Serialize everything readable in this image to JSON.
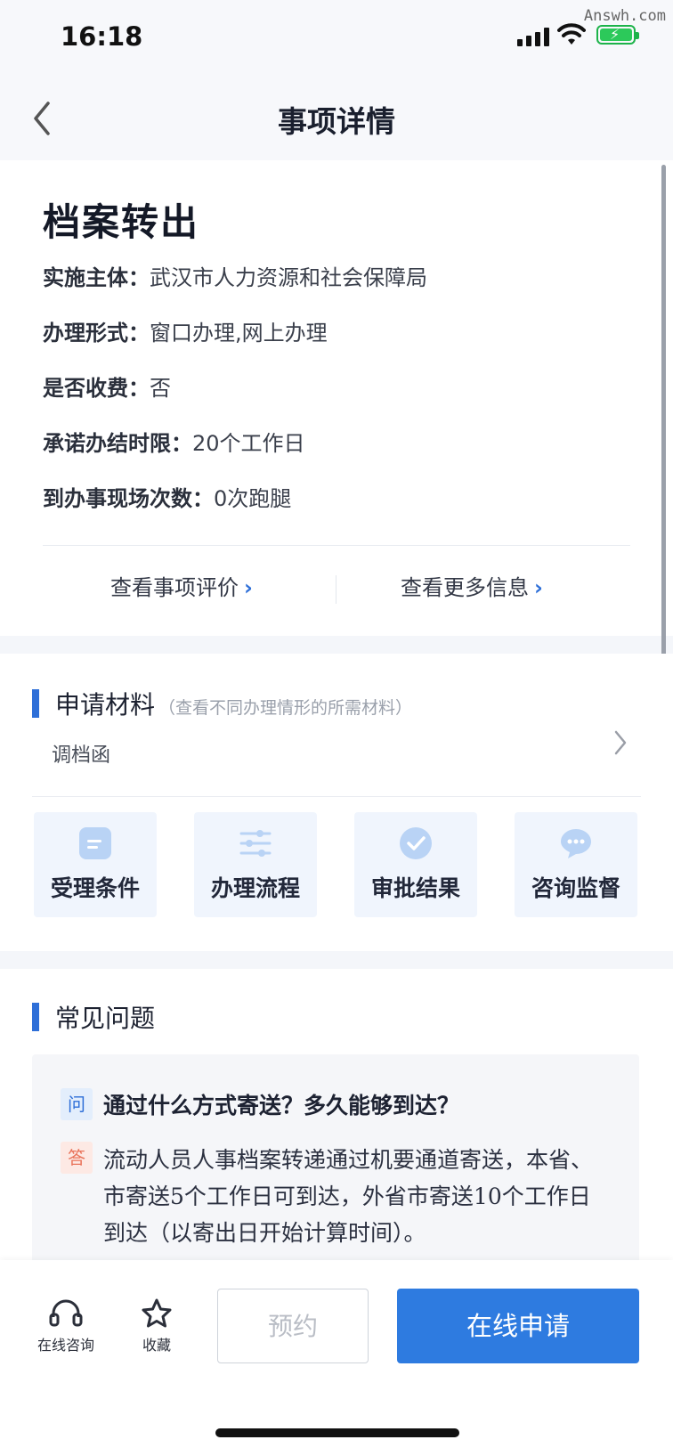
{
  "status": {
    "time": "16:18",
    "watermark": "Answh.com"
  },
  "nav": {
    "title": "事项详情"
  },
  "item": {
    "title": "档案转出",
    "fields": [
      {
        "label": "实施主体：",
        "value": "武汉市人力资源和社会保障局"
      },
      {
        "label": "办理形式：",
        "value": "窗口办理,网上办理"
      },
      {
        "label": "是否收费：",
        "value": "否"
      },
      {
        "label": "承诺办结时限：",
        "value": "20个工作日"
      },
      {
        "label": "到办事现场次数：",
        "value": "0次跑腿"
      }
    ],
    "links": {
      "evaluate": "查看事项评价",
      "more": "查看更多信息"
    }
  },
  "materials": {
    "title": "申请材料",
    "hint": "（查看不同办理情形的所需材料）",
    "item": "调档函"
  },
  "tiles": [
    {
      "label": "受理条件",
      "icon": "document-icon"
    },
    {
      "label": "办理流程",
      "icon": "sliders-icon"
    },
    {
      "label": "审批结果",
      "icon": "check-circle-icon"
    },
    {
      "label": "咨询监督",
      "icon": "chat-bubble-icon"
    }
  ],
  "faq": {
    "title": "常见问题",
    "q_badge": "问",
    "a_badge": "答",
    "question": "通过什么方式寄送？多久能够到达？",
    "answer": "流动人员人事档案转递通过机要通道寄送，本省、市寄送5个工作日可到达，外省市寄送10个工作日到达（以寄出日开始计算时间）。"
  },
  "bottom": {
    "consult": "在线咨询",
    "favorite": "收藏",
    "reserve": "预约",
    "apply": "在线申请"
  },
  "colors": {
    "accent": "#2e7be0",
    "answer_badge": "#e9735a"
  }
}
